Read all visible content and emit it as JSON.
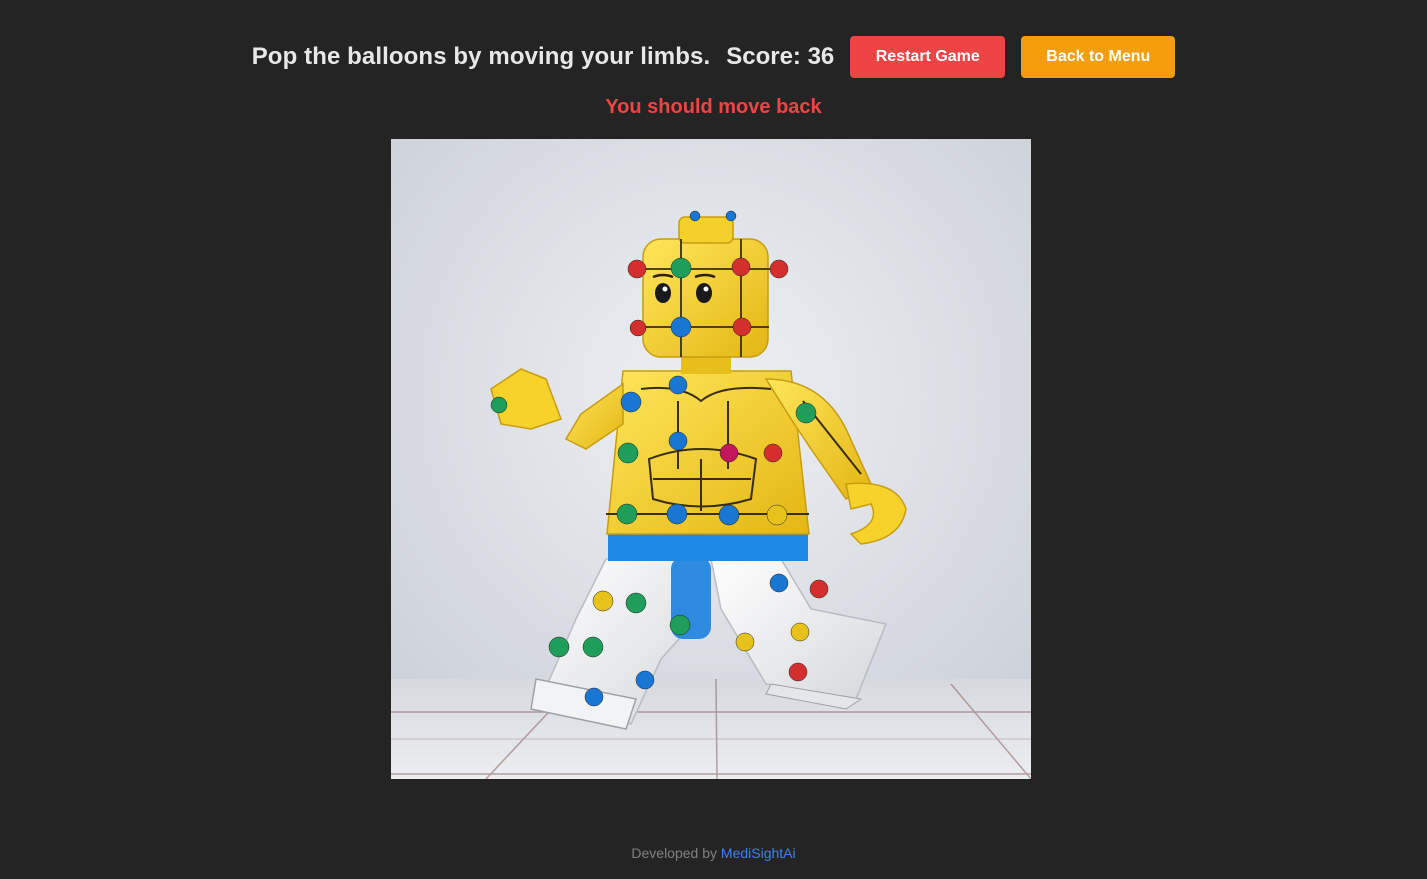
{
  "header": {
    "instructions": "Pop the balloons by moving your limbs.",
    "score_label": "Score: 36",
    "restart_label": "Restart Game",
    "menu_label": "Back to Menu"
  },
  "status": {
    "warning": "You should move back"
  },
  "canvas": {
    "figure": "lego-minifigure-with-tracking-dots"
  },
  "footer": {
    "prefix": "Developed by",
    "brand": "MediSightAi"
  },
  "colors": {
    "background": "#242424",
    "restart": "#ef4444",
    "menu": "#f59e0b",
    "warning": "#ef4444",
    "brand_link": "#3b82f6"
  }
}
